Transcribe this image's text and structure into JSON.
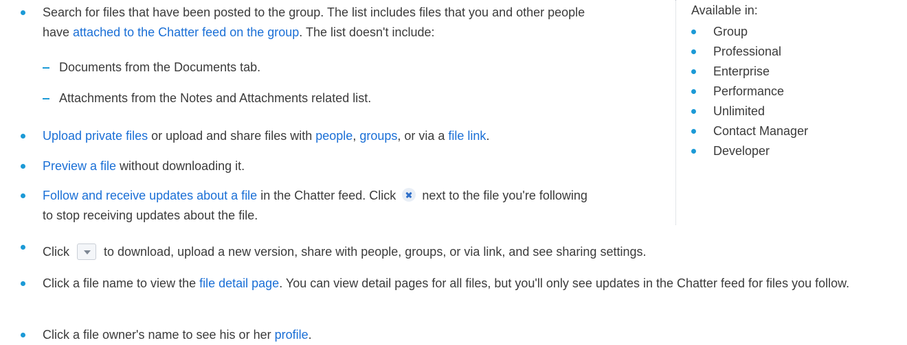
{
  "items": [
    {
      "lead": "Search for files that have been posted to the group. The list includes files that you and other people have ",
      "link": "attached to the Chatter feed on the group",
      "tail": ". The list doesn't include:"
    },
    {
      "link1": "Upload private files",
      "text1": " or upload and share files with ",
      "link2": "people",
      "text2": ", ",
      "link3": "groups",
      "text3": ", or via a ",
      "link4": "file link",
      "text4": "."
    },
    {
      "link": "Preview a file",
      "tail": " without downloading it."
    },
    {
      "link": "Follow and receive updates about a file",
      "mid": " in the Chatter feed. Click ",
      "tail": " next to the file you're following to stop receiving updates about the file."
    },
    {
      "lead": "Click ",
      "tail": " to download, upload a new version, share with people, groups, or via link, and see sharing settings."
    },
    {
      "lead": "Click a file name to view the ",
      "link": "file detail page",
      "tail": ". You can view detail pages for all files, but you'll only see updates in the Chatter feed for files you follow."
    },
    {
      "lead": "Click a file owner's name to see his or her ",
      "link": "profile",
      "tail": "."
    }
  ],
  "subitems": [
    "Documents from the Documents tab.",
    "Attachments from the Notes and Attachments related list."
  ],
  "sidebar": {
    "title": "Available in:",
    "editions": [
      "Group",
      "Professional",
      "Enterprise",
      "Performance",
      "Unlimited",
      "Contact Manager",
      "Developer"
    ]
  },
  "icons": {
    "unfollow": "x-icon",
    "dropdown": "dropdown-arrow-icon"
  }
}
